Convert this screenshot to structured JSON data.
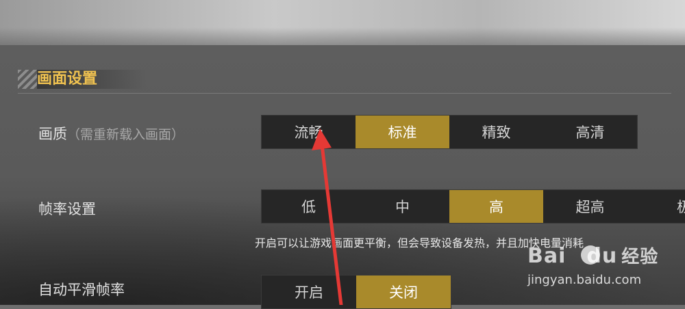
{
  "section": {
    "title": "画面设置"
  },
  "quality": {
    "label": "画质",
    "hint": "（需重新载入画面）",
    "options": [
      "流畅",
      "标准",
      "精致",
      "高清"
    ],
    "selected": "标准"
  },
  "framerate": {
    "label": "帧率设置",
    "options": [
      "低",
      "中",
      "高",
      "超高",
      "极"
    ],
    "selected": "高",
    "description": "开启可以让游戏画面更平衡，但会导致设备发热，并且加快电量消耗"
  },
  "smooth": {
    "label": "自动平滑帧率",
    "options": [
      "开启",
      "关闭"
    ],
    "selected": "关闭"
  },
  "watermark": {
    "brand": "Bai",
    "brand2": "du",
    "brand3": "经验",
    "url": "jingyan.baidu.com"
  },
  "colors": {
    "accent": "#f0c250",
    "selected": "#a98a2b",
    "arrow": "#e53935"
  }
}
